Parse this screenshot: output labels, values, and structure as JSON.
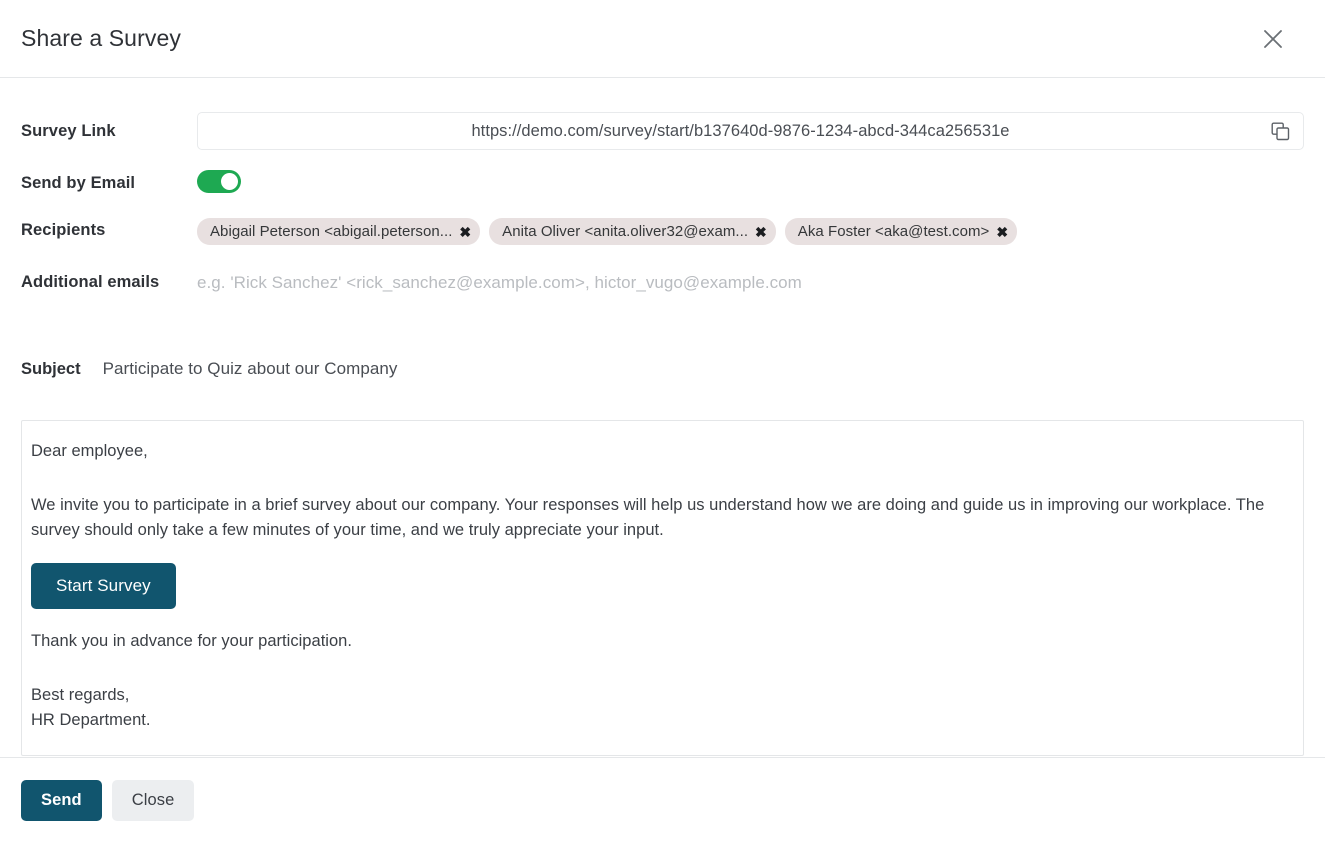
{
  "dialog": {
    "title": "Share a Survey",
    "close_icon": "close-icon"
  },
  "colors": {
    "accent_teal": "#11556e",
    "toggle_on_green": "#1ea952",
    "tag_background": "#e8e0e0",
    "close_button_background": "#eceef0",
    "border": "#e5e7e9",
    "placeholder_text": "#b9bcc0"
  },
  "fields": {
    "survey_link": {
      "label": "Survey Link",
      "value": "https://demo.com/survey/start/b137640d-9876-1234-abcd-344ca256531e",
      "copy_icon": "copy-icon"
    },
    "send_by_email": {
      "label": "Send by Email",
      "state": "on"
    },
    "recipients": {
      "label": "Recipients",
      "tags": [
        {
          "label": "Abigail Peterson <abigail.peterson...",
          "remove": "✖"
        },
        {
          "label": "Anita Oliver <anita.oliver32@exam...",
          "remove": "✖"
        },
        {
          "label": "Aka Foster <aka@test.com>",
          "remove": "✖"
        }
      ]
    },
    "additional_emails": {
      "label": "Additional emails",
      "value": "",
      "placeholder": "e.g.  'Rick Sanchez' <rick_sanchez@example.com>, hictor_vugo@example.com"
    },
    "subject": {
      "label": "Subject",
      "value": "Participate to Quiz about our Company"
    }
  },
  "mail_body": {
    "greeting": "Dear employee,",
    "invitation": "We invite you to participate in a brief survey about our company. Your responses will help us understand how we are doing and guide us in improving our workplace. The survey should only take a few minutes of your time, and we truly appreciate your input.",
    "cta_label": "Start Survey",
    "thanks": "Thank you in advance for your participation.",
    "signoff_line1": "Best regards,",
    "signoff_line2": "HR Department."
  },
  "footer": {
    "send_label": "Send",
    "close_label": "Close"
  }
}
